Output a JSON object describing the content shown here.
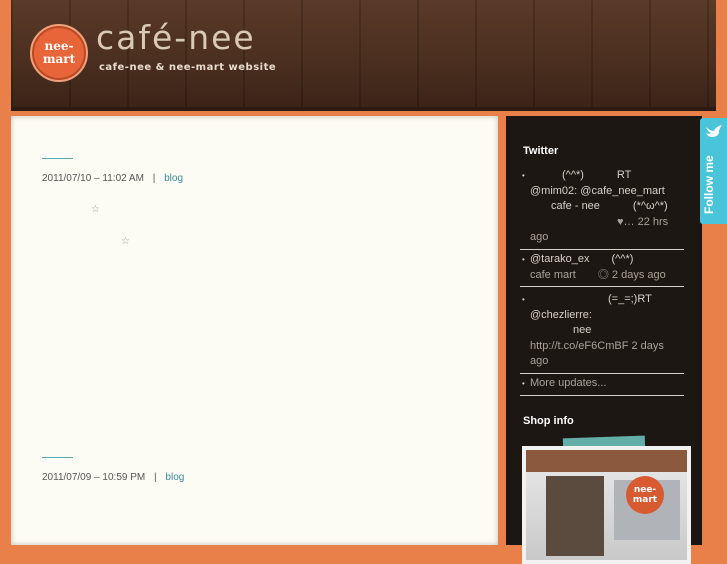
{
  "header": {
    "logo_text_line1": "nee-",
    "logo_text_line2": "mart",
    "title": "café-nee",
    "subtitle": "cafe-nee & nee-mart website"
  },
  "posts": [
    {
      "date": "2011/07/10 – 11:02 AM",
      "separator": "|",
      "category": "blog",
      "stars": [
        "☆",
        "☆"
      ]
    },
    {
      "date": "2011/07/09 – 10:59 PM",
      "separator": "|",
      "category": "blog"
    }
  ],
  "sidebar": {
    "twitter_title": "Twitter",
    "tweets": [
      {
        "lines": [
          "(^^*)　　　RT",
          "@mim02: @cafe_nee_mart",
          "cafe - nee　　　(*^ω^*)",
          "♥… 22 hrs",
          "ago"
        ]
      },
      {
        "lines": [
          "@tarako_ex　　(^^*)",
          "cafe mart　　◎ 2 days ago"
        ]
      },
      {
        "lines": [
          "(=_=;)RT",
          "@chezlierre:",
          "nee",
          "http://t.co/eF6CmBF 2 days",
          "ago"
        ]
      }
    ],
    "more_updates": "More updates...",
    "shop_title": "Shop info",
    "shop_sign_line1": "nee-",
    "shop_sign_line2": "mart"
  },
  "follow": {
    "label": "Follow me",
    "icon": "bird-icon"
  }
}
